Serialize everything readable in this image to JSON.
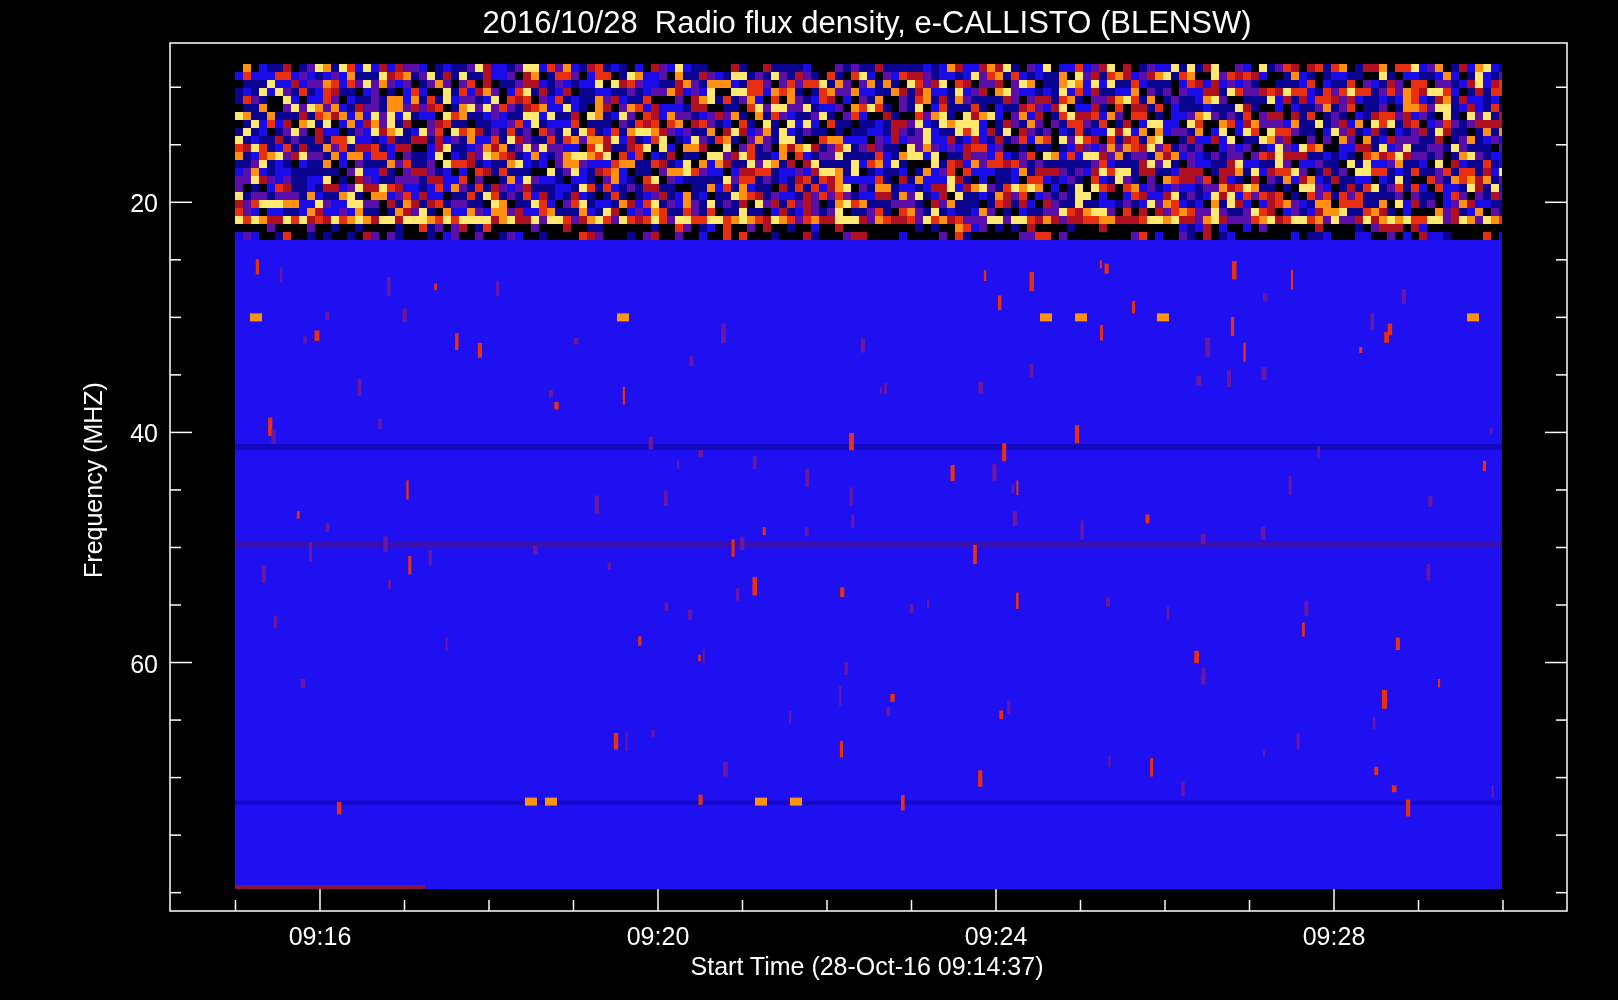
{
  "title": "2016/10/28  Radio flux density, e-CALLISTO (BLENSW)",
  "chart": {
    "ylabel": "Frequency (MHZ)",
    "xlabel": "Start Time (28-Oct-16 09:14:37)",
    "y_tick_labels": [
      "20",
      "40",
      "60"
    ],
    "x_tick_labels": [
      "09:16",
      "09:20",
      "09:24",
      "09:28"
    ]
  }
}
